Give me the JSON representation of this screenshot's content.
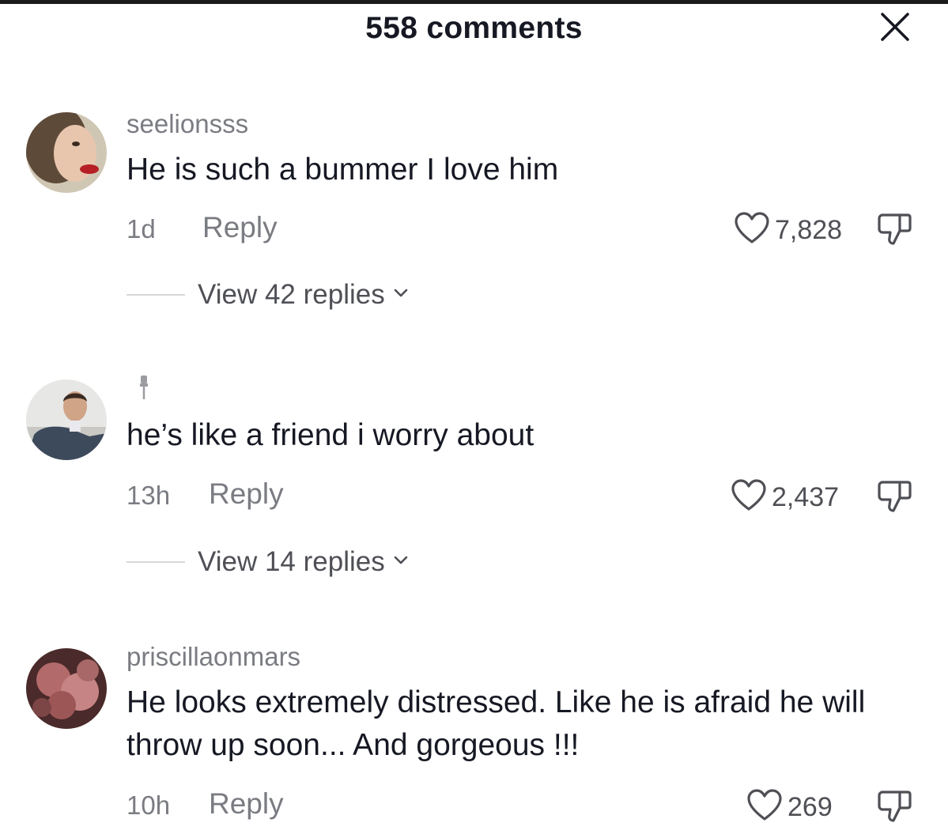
{
  "header": {
    "title": "558 comments",
    "close_icon": "close-icon"
  },
  "comments": [
    {
      "username": "seelionsss",
      "text": "He is such a bummer I love him",
      "time": "1d",
      "reply_label": "Reply",
      "likes": "7,828",
      "view_replies": "View 42 replies",
      "avatar": "woman-red-lips-avatar"
    },
    {
      "username": "",
      "text": "he’s like a friend i worry about",
      "time": "13h",
      "reply_label": "Reply",
      "likes": "2,437",
      "view_replies": "View 14 replies",
      "avatar": "man-in-suit-avatar"
    },
    {
      "username": "priscillaonmars",
      "text": "He looks extremely distressed. Like he is afraid he will throw up soon... And gorgeous !!!",
      "time": "10h",
      "reply_label": "Reply",
      "likes": "269",
      "avatar": "flowers-avatar"
    }
  ],
  "colors": {
    "text_primary": "#161823",
    "text_secondary": "#7a7c82",
    "divider": "#d6d7da"
  }
}
